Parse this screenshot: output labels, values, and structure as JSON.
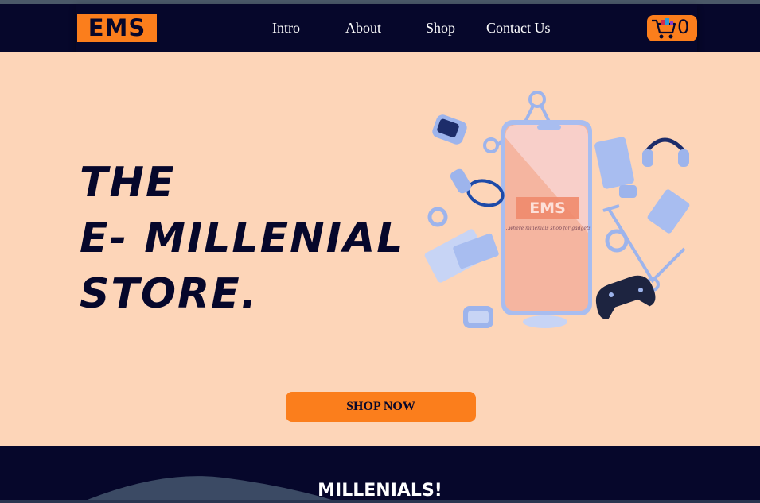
{
  "brand": {
    "logo_text": "EMS"
  },
  "nav": {
    "links": [
      "Intro",
      "About",
      "Shop",
      "Contact Us"
    ]
  },
  "cart": {
    "count": "0",
    "icon": "shopping-cart-icon"
  },
  "hero": {
    "title_lines": [
      "THE",
      "E- MILLENIAL",
      "STORE."
    ],
    "phone_logo": "EMS",
    "phone_tagline": "...where millenials shop for gadgets",
    "cta_label": "SHOP NOW"
  },
  "section2": {
    "heading": "MILLENIALS!"
  },
  "colors": {
    "navy": "#06072b",
    "orange": "#fb7e1c",
    "peach": "#fdd5b8",
    "gadget_blue": "#9db4ec"
  }
}
